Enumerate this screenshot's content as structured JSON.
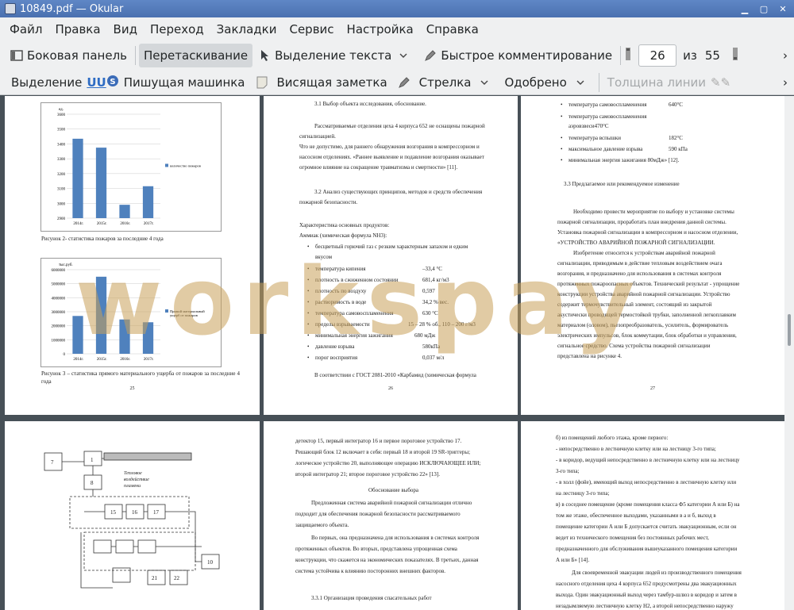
{
  "window": {
    "title": "10849.pdf — Okular"
  },
  "menu": [
    "Файл",
    "Правка",
    "Вид",
    "Переход",
    "Закладки",
    "Сервис",
    "Настройка",
    "Справка"
  ],
  "toolbar1": {
    "sidebar": "Боковая панель",
    "drag": "Перетаскивание",
    "text_select": "Выделение текста",
    "quick_comment": "Быстрое комментирование",
    "page_current": "26",
    "page_of": "из",
    "page_total": "55"
  },
  "toolbar2": {
    "highlight": "Выделение",
    "typewriter": "Пишущая машинка",
    "sticky_note": "Висящая заметка",
    "arrow": "Стрелка",
    "stamp": "Одобрено",
    "line_width": "Толщина линии"
  },
  "watermark": "workspay",
  "pages": {
    "p25": {
      "num": "25",
      "chart1": {
        "ylabel": "ед.",
        "legend": "количество пожаров",
        "caption": "Рисунок 2- статистика пожаров за последние 4 года"
      },
      "chart2": {
        "ylabel": "тыс.руб.",
        "legend": "Прямой материальный ущерб от пожаров",
        "caption": "Рисунок 3 – статистика прямого материального ущерба от пожаров за последние 4 года"
      }
    },
    "p26": {
      "num": "26",
      "lines": [
        "3.1 Выбор объекта исследования, обоснование.",
        "Рассматриваемые отделения цеха 4 корпуса 652 не оснащены пожарной",
        "сигнализацией.",
        "Что не допустимо, для раннего обнаружения возгорания в компрессорном и",
        "насосном отделениях. «Раннее выявление и подавление возгорания оказывает",
        "огромное влияние на сокращение травматизма и смертности» [11].",
        "3.2 Анализ существующих принципов, методов и средств обеспечения",
        "пожарной безопасности.",
        "Характеристика основных продуктов:",
        "Аммиак (химическая формула NH3):"
      ],
      "bullets": [
        "бесцветный горючий газ с резким характерным запахом и едким",
        "температура кипения",
        "плотность в сжиженном состоянии",
        "плотность по воздуху",
        "растворимость в воде",
        "температура самовоспламенения",
        "пределы взрываемости",
        "минимальная энергия зажигания",
        "давление взрыва",
        "порог восприятия"
      ],
      "bullet_cont": "вкусом",
      "values": [
        "–33,4 °С",
        "681,4 кг/м3",
        "0,597",
        "34,2 % вес.",
        "630 °С",
        "15 – 28 % об., 110 – 200 г/м3",
        "680 мДж",
        "580кПа",
        "0,037 м/л"
      ],
      "footer": "В соответствии с ГОСТ 2081-2010 «Карбамид (химическая формула"
    },
    "p27": {
      "num": "27",
      "bullets": [
        "температура самовоспламенения",
        "температура самовоспламенения",
        "аэровзвеси470°С",
        "температура вспышки",
        "максимальное давление взрыва",
        "минимальная энергия зажигания 80мДж» [12]."
      ],
      "values": [
        "640°С",
        "182°С",
        "590 кПа"
      ],
      "lines": [
        "3.3 Предлагаемое или рекомендуемое изменение",
        "Необходимо провести мероприятие по выбору и установке системы",
        "пожарной сигнализации, проработать план внедрения данной системы.",
        "Установка пожарной сигнализации в компрессорном и насосном отделении,",
        "«УСТРОЙСТВО АВАРИЙНОЙ ПОЖАРНОЙ СИГНАЛИЗАЦИИ.",
        "Изобретение относится к устройствам аварийной пожарной",
        "сигнализации, приводимым в действие тепловым воздействием очага",
        "возгорания, и предназначено для использования в системах контроля",
        "протяженных пожароопасных объектов. Технический результат - упрощение",
        "конструкции устройства аварийной пожарной сигнализации. Устройство",
        "содержит термочувствительный элемент, состоящий из закрытой",
        "акустически проводящей термостойкой трубки, заполненной легкоплавким",
        "материалом (оловом), пьезопреобразователь, усилитель, формирователь",
        "электрических импульсов, блок коммутации, блок обработки и управления,",
        "сигнальное средство. Схема устройства пожарной сигнализации",
        "представлена на рисунке 4."
      ]
    },
    "p28": {
      "labels": [
        "Тепловое",
        "воздействие",
        "пламени"
      ]
    },
    "p29": {
      "lines": [
        "детектор 15, первый интегратор 16 и первое пороговое устройство 17.",
        "Решающий блок 12 включает в себя: первый 18 и второй 19 SR-триггеры;",
        "логическое устройство 20, выполняющее операцию ИСКЛЮЧАЮЩЕЕ ИЛИ;",
        "второй интегратор 21; второе пороговое устройство 22» [13].",
        "Обоснование выбора",
        "Предложенная система аварийной пожарной сигнализации отлично",
        "подходит для обеспечения пожарной безопасности рассматриваемого",
        "защищаемого объекта.",
        "Во первых, она предназначена для использования в системах контроля",
        "протяженных объектов. Во вторых, представлена упрощенная схема",
        "конструкции, что скажется на экономических показателях. В третьих, данная",
        "система устойчива к влиянию посторонних внешних факторов.",
        "3.3.1 Организация проведения спасательных работ"
      ]
    },
    "p30": {
      "lines": [
        "б) из помещений любого этажа, кроме первого:",
        "- непосредственно в лестничную клетку или на лестницу 3-го типа;",
        "- в коридор, ведущий непосредственно в лестничную клетку или на лестницу",
        "3-го типа;",
        "- в холл (фойе), имеющий выход непосредственно в лестничную клетку или",
        "на лестницу 3-го типа;",
        "в) в соседнее помещение (кроме помещения класса Ф5 категории А или Б) на",
        "том же этаже, обеспеченное выходами, указанными в а и б, выход в",
        "помещение категории А или Б допускается считать эвакуационным, если он",
        "ведет из технического помещения без постоянных рабочих мест,",
        "предназначенного для обслуживания вышеуказанного помещения категории",
        "А или Б» [14].",
        "Для своевременной эвакуации людей из производственного помещения",
        "насосного отделения цеха 4 корпуса 652 предусмотрены два эвакуационных",
        "выхода. Один эвакуационный выход через тамбур-шлюз в коридор и затем в",
        "незадымляемую лестничную клетку Н2, а второй непосредственно наружу"
      ]
    }
  },
  "chart_data": [
    {
      "type": "bar",
      "categories": [
        "2014г.",
        "2015г.",
        "2016г.",
        "2017г."
      ],
      "series": [
        {
          "name": "количество пожаров",
          "values": [
            3435,
            3375,
            2990,
            3115
          ]
        }
      ],
      "ylabel": "ед.",
      "ylim": [
        2900,
        3600
      ],
      "yticks": [
        "2900",
        "3000",
        "3100",
        "3200",
        "3300",
        "3400",
        "3500",
        "3600"
      ],
      "legend": "right"
    },
    {
      "type": "bar",
      "categories": [
        "2014г.",
        "2015г.",
        "2016г.",
        "2017г."
      ],
      "series": [
        {
          "name": "Прямой материальный ущерб от пожаров",
          "values": [
            2700000,
            5500000,
            2450000,
            2250000
          ]
        }
      ],
      "ylabel": "тыс.руб.",
      "ylim": [
        0,
        6000000
      ],
      "yticks": [
        "0",
        "1000000",
        "2000000",
        "3000000",
        "4000000",
        "5000000",
        "6000000"
      ],
      "legend": "right"
    }
  ]
}
